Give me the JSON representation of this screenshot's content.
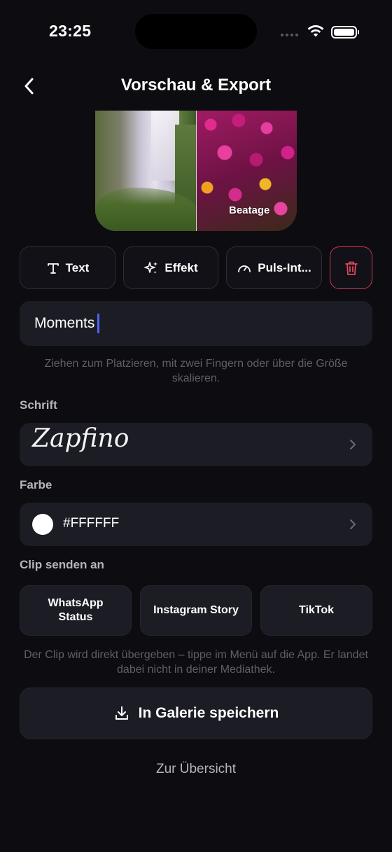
{
  "status_bar": {
    "time": "23:25"
  },
  "header": {
    "title": "Vorschau & Export"
  },
  "preview": {
    "label": "Beatage"
  },
  "tools": {
    "text_label": "Text",
    "effekt_label": "Effekt",
    "puls_label": "Puls-Int..."
  },
  "text_field": {
    "value": "Moments"
  },
  "hint_text": "Ziehen zum Platzieren, mit zwei Fingern oder über die Größe skalieren.",
  "font_section": {
    "label": "Schrift",
    "font_name": "Zapfino"
  },
  "color_section": {
    "label": "Farbe",
    "value": "#FFFFFF",
    "swatch": "#ffffff"
  },
  "share_section": {
    "label": "Clip senden an",
    "targets": [
      "WhatsApp Status",
      "Instagram Story",
      "TikTok"
    ],
    "hint": "Der Clip wird direkt übergeben – tippe im Menü auf die App. Er landet dabei nicht in deiner Mediathek."
  },
  "save_button": {
    "label": "In Galerie speichern"
  },
  "overview_link": {
    "label": "Zur Übersicht"
  },
  "colors": {
    "background": "#0c0c11",
    "accent_caret": "#4f63ff",
    "delete": "#c93a4d"
  }
}
